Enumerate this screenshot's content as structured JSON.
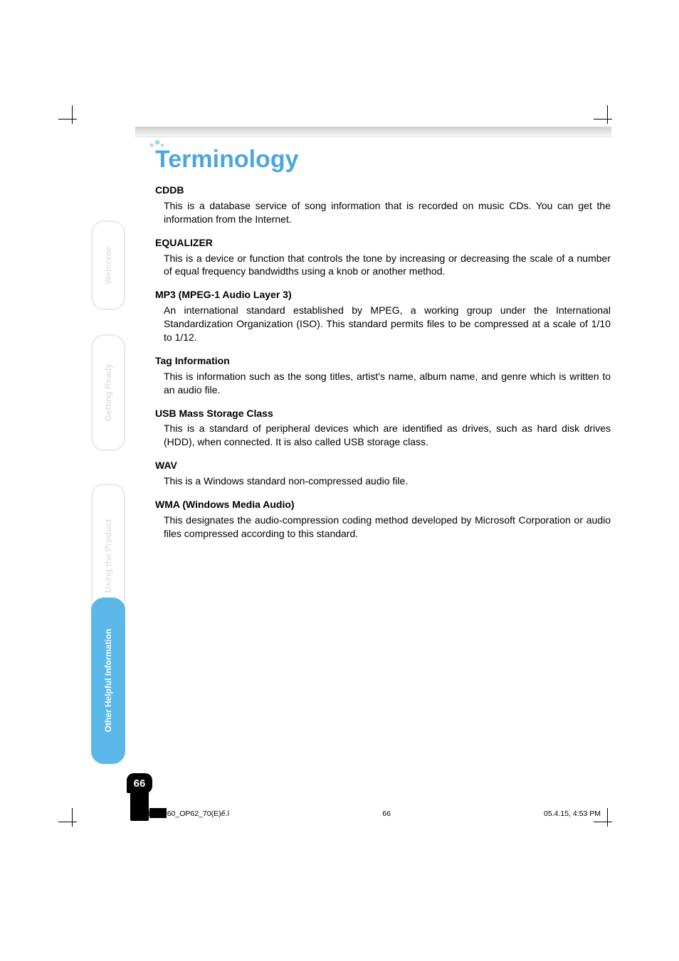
{
  "title": "Terminology",
  "terms": [
    {
      "heading": "CDDB",
      "body": "This is a database service of song information that is recorded on music CDs. You can get the information from the Internet."
    },
    {
      "heading": "EQUALIZER",
      "body": "This is a device or function that controls the tone by increasing or decreasing the scale of a number of equal frequency bandwidths using a knob or another method."
    },
    {
      "heading": "MP3 (MPEG-1 Audio Layer 3)",
      "body": "An international standard established by MPEG, a working group under the International Standardization Organization (ISO). This standard permits files to be compressed at a scale of 1/10 to 1/12."
    },
    {
      "heading": "Tag Information",
      "body": "This is information such as the song titles, artist's name, album name, and genre which is written to an audio file."
    },
    {
      "heading": "USB Mass Storage Class",
      "body": "This is a standard of peripheral devices which are identified as drives, such as hard disk drives (HDD), when connected. It is also called USB storage class."
    },
    {
      "heading": "WAV",
      "body": "This is a Windows standard non-compressed audio file."
    },
    {
      "heading": "WMA (Windows Media Audio)",
      "body": "This designates the audio-compression coding method developed by Microsoft Corporation or audio files compressed according to this standard."
    }
  ],
  "tabs": {
    "welcome": "Welcome",
    "getting": "Getting Ready",
    "using": "Using the Product",
    "other": "Other Helpful Information"
  },
  "page_number": "66",
  "footer": {
    "left": "gigabeatF60_OP62_70(E)ế.î",
    "center": "66",
    "right": "05.4.15, 4:53 PM"
  }
}
